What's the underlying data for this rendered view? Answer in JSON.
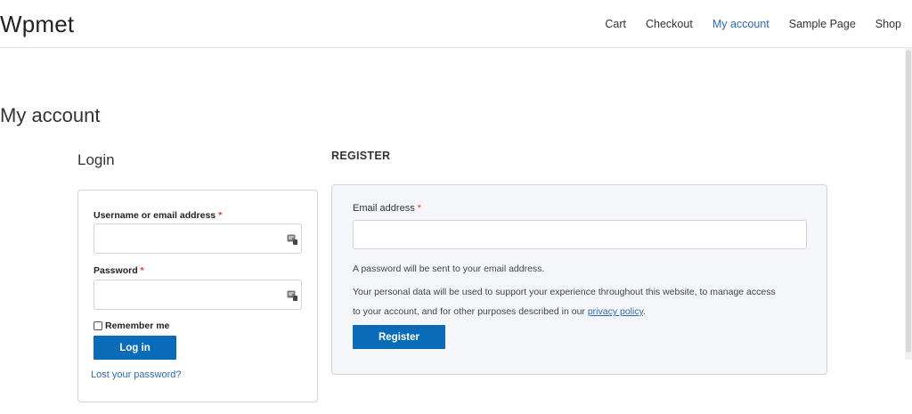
{
  "header": {
    "site_title": "Wpmet",
    "nav": [
      {
        "label": "Cart"
      },
      {
        "label": "Checkout"
      },
      {
        "label": "My account"
      },
      {
        "label": "Sample Page"
      },
      {
        "label": "Shop"
      }
    ],
    "active_nav": "My account"
  },
  "page": {
    "title": "My account"
  },
  "login": {
    "heading": "Login",
    "username_label": "Username or email address",
    "password_label": "Password",
    "required_mark": "*",
    "username_value": "",
    "password_value": "",
    "remember_label": "Remember me",
    "remember_checked": false,
    "submit_label": "Log in",
    "lost_password_label": "Lost your password?"
  },
  "register": {
    "heading": "REGISTER",
    "email_label": "Email address",
    "required_mark": "*",
    "email_value": "",
    "password_note": "A password will be sent to your email address.",
    "privacy_text_line1": "Your personal data will be used to support your experience throughout this website, to manage access",
    "privacy_text_line2_prefix": "to your account, and for other purposes described in our ",
    "privacy_link": "privacy policy",
    "privacy_text_suffix": ".",
    "submit_label": "Register"
  },
  "colors": {
    "accent": "#0a6cb8",
    "link": "#2b6cb0",
    "required": "#e2401c",
    "register_bg": "#f5f6fa"
  }
}
